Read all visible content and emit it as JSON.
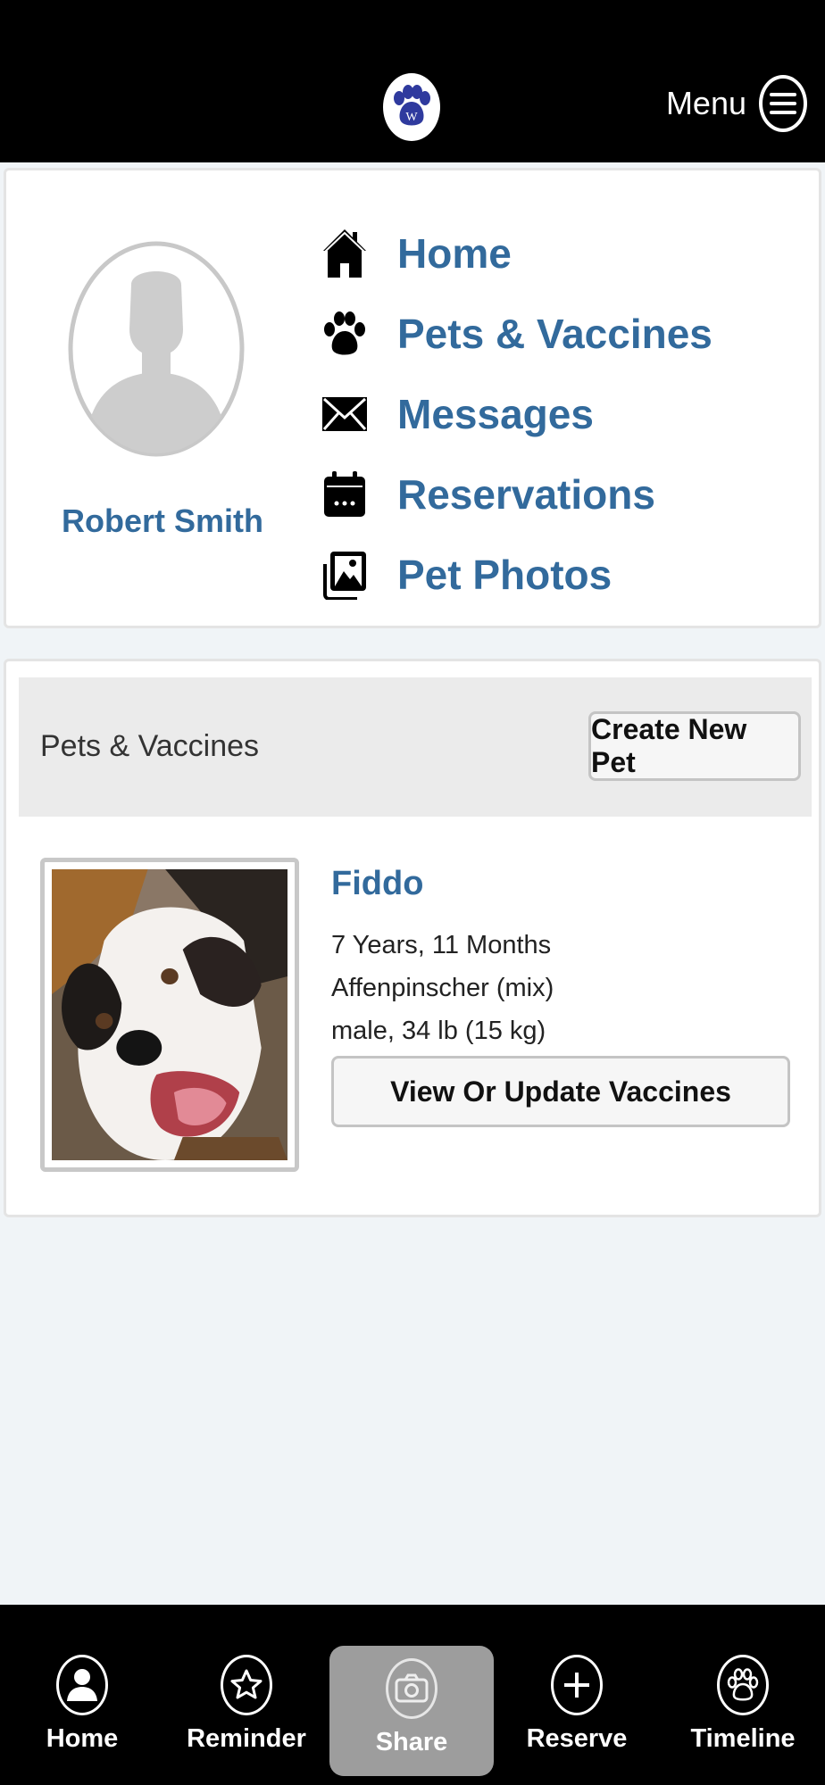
{
  "header": {
    "logo_icon": "paw-logo-icon",
    "logo_letter": "W",
    "menu_label": "Menu"
  },
  "profile": {
    "user_name": "Robert Smith",
    "nav": [
      {
        "label": "Home",
        "icon": "home-icon"
      },
      {
        "label": "Pets & Vaccines",
        "icon": "paw-icon"
      },
      {
        "label": "Messages",
        "icon": "envelope-icon"
      },
      {
        "label": "Reservations",
        "icon": "calendar-icon"
      },
      {
        "label": "Pet Photos",
        "icon": "photos-icon"
      }
    ]
  },
  "pets_section": {
    "title": "Pets & Vaccines",
    "create_button": "Create New Pet",
    "pets": [
      {
        "name": "Fiddo",
        "age": "7 Years, 11 Months",
        "breed": "Affenpinscher (mix)",
        "details": "male, 34 lb (15 kg)",
        "vaccines_button": "View Or Update Vaccines"
      }
    ]
  },
  "bottom_nav": [
    {
      "label": "Home",
      "icon": "person-icon",
      "active": false
    },
    {
      "label": "Reminder",
      "icon": "star-icon",
      "active": false
    },
    {
      "label": "Share",
      "icon": "camera-icon",
      "active": true
    },
    {
      "label": "Reserve",
      "icon": "plus-icon",
      "active": false
    },
    {
      "label": "Timeline",
      "icon": "paw-icon",
      "active": false
    }
  ],
  "colors": {
    "accent": "#326a9c",
    "bar_background": "#000000",
    "page_background": "#f0f4f7",
    "logo_paw": "#2f3a9e"
  }
}
